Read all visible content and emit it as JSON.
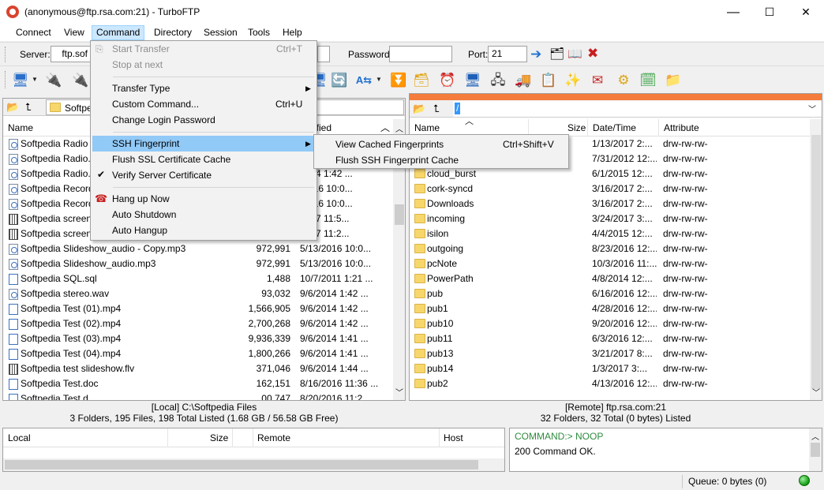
{
  "window": {
    "title": "(anonymous@ftp.rsa.com:21) - TurboFTP",
    "minimize": "—",
    "maximize": "☐",
    "close": "✕"
  },
  "menubar": [
    "Connect",
    "View",
    "Command",
    "Directory",
    "Session",
    "Tools",
    "Help"
  ],
  "connection": {
    "server_label": "Server:",
    "server_value": "ftp.sof",
    "password_label": "Password:",
    "password_value": "",
    "port_label": "Port:",
    "port_value": "21"
  },
  "command_menu": {
    "items": [
      {
        "label": "Start Transfer",
        "shortcut": "Ctrl+T",
        "disabled": true
      },
      {
        "label": "Stop at next",
        "shortcut": "",
        "disabled": true
      },
      {
        "label": "Transfer Type",
        "shortcut": "",
        "submenu": true
      },
      {
        "label": "Custom Command...",
        "shortcut": "Ctrl+U"
      },
      {
        "label": "Change Login Password",
        "shortcut": ""
      },
      {
        "label": "SSH Fingerprint",
        "shortcut": "",
        "submenu": true,
        "highlighted": true
      },
      {
        "label": "Flush SSL Certificate Cache",
        "shortcut": ""
      },
      {
        "label": "Verify Server Certificate",
        "shortcut": "",
        "checked": true
      },
      {
        "label": "Hang up Now",
        "shortcut": ""
      },
      {
        "label": "Auto Shutdown",
        "shortcut": ""
      },
      {
        "label": "Auto Hangup",
        "shortcut": ""
      }
    ]
  },
  "ssh_submenu": {
    "items": [
      {
        "label": "View Cached Fingerprints",
        "shortcut": "Ctrl+Shift+V"
      },
      {
        "label": "Flush SSH Fingerprint Cache",
        "shortcut": ""
      }
    ]
  },
  "local": {
    "path": "Softped",
    "columns": {
      "name": "Name",
      "modified": "ified"
    },
    "files": [
      {
        "name": "Softpedia Radio .",
        "size": "",
        "date": "",
        "icon": "aud"
      },
      {
        "name": "Softpedia Radio.r",
        "size": "",
        "date": "",
        "icon": "aud"
      },
      {
        "name": "Softpedia Radio.v",
        "size": "",
        "date": "2014 1:42 ...",
        "icon": "aud"
      },
      {
        "name": "Softpedia Record",
        "size": "",
        "date": "/2016 10:0...",
        "icon": "aud"
      },
      {
        "name": "Softpedia Record",
        "size": "",
        "date": "/2016 10:0...",
        "icon": "aud"
      },
      {
        "name": "Softpedia screen",
        "size": "",
        "date": "2017 11:5...",
        "icon": "vid"
      },
      {
        "name": "Softpedia screen",
        "size": "",
        "date": "2017 11:2...",
        "icon": "vid"
      },
      {
        "name": "Softpedia Slideshow_audio - Copy.mp3",
        "size": "972,991",
        "date": "5/13/2016 10:0...",
        "icon": "aud"
      },
      {
        "name": "Softpedia Slideshow_audio.mp3",
        "size": "972,991",
        "date": "5/13/2016 10:0...",
        "icon": "aud"
      },
      {
        "name": "Softpedia SQL.sql",
        "size": "1,488",
        "date": "10/7/2011 1:21 ...",
        "icon": "doc"
      },
      {
        "name": "Softpedia stereo.wav",
        "size": "93,032",
        "date": "9/6/2014 1:42 ...",
        "icon": "aud"
      },
      {
        "name": "Softpedia Test (01).mp4",
        "size": "1,566,905",
        "date": "9/6/2014 1:42 ...",
        "icon": "doc"
      },
      {
        "name": "Softpedia Test (02).mp4",
        "size": "2,700,268",
        "date": "9/6/2014 1:42 ...",
        "icon": "doc"
      },
      {
        "name": "Softpedia Test (03).mp4",
        "size": "9,936,339",
        "date": "9/6/2014 1:41 ...",
        "icon": "doc"
      },
      {
        "name": "Softpedia Test (04).mp4",
        "size": "1,800,266",
        "date": "9/6/2014 1:41 ...",
        "icon": "doc"
      },
      {
        "name": "Softpedia test slideshow.flv",
        "size": "371,046",
        "date": "9/6/2014 1:44 ...",
        "icon": "vid"
      },
      {
        "name": "Softpedia Test.doc",
        "size": "162,151",
        "date": "8/16/2016 11:36 ...",
        "icon": "doc"
      },
      {
        "name": "Softpedia Test.d...",
        "size": "00,747",
        "date": "8/20/2016 11:2...",
        "icon": "doc"
      }
    ],
    "status_line1": "[Local] C:\\Softpedia Files",
    "status_line2": "3 Folders, 195 Files, 198 Total Listed (1.68 GB / 56.58 GB Free)"
  },
  "remote": {
    "path": "/",
    "columns": {
      "name": "Name",
      "size": "Size",
      "date": "Date/Time",
      "attr": "Attribute"
    },
    "rows": [
      {
        "name": "",
        "date": "1/13/2017 2:...",
        "attr": "drw-rw-rw-"
      },
      {
        "name": "bustech",
        "date": "7/31/2012 12:...",
        "attr": "drw-rw-rw-"
      },
      {
        "name": "cloud_burst",
        "date": "6/1/2015 12:...",
        "attr": "drw-rw-rw-"
      },
      {
        "name": "cork-syncd",
        "date": "3/16/2017 2:...",
        "attr": "drw-rw-rw-"
      },
      {
        "name": "Downloads",
        "date": "3/16/2017 2:...",
        "attr": "drw-rw-rw-"
      },
      {
        "name": "incoming",
        "date": "3/24/2017 3:...",
        "attr": "drw-rw-rw-"
      },
      {
        "name": "isilon",
        "date": "4/4/2015 12:...",
        "attr": "drw-rw-rw-"
      },
      {
        "name": "outgoing",
        "date": "8/23/2016 12:...",
        "attr": "drw-rw-rw-"
      },
      {
        "name": "pcNote",
        "date": "10/3/2016 11:...",
        "attr": "drw-rw-rw-"
      },
      {
        "name": "PowerPath",
        "date": "4/8/2014 12:...",
        "attr": "drw-rw-rw-"
      },
      {
        "name": "pub",
        "date": "6/16/2016 12:...",
        "attr": "drw-rw-rw-"
      },
      {
        "name": "pub1",
        "date": "4/28/2016 12:...",
        "attr": "drw-rw-rw-"
      },
      {
        "name": "pub10",
        "date": "9/20/2016 12:...",
        "attr": "drw-rw-rw-"
      },
      {
        "name": "pub11",
        "date": "6/3/2016 12:...",
        "attr": "drw-rw-rw-"
      },
      {
        "name": "pub13",
        "date": "3/21/2017 8:...",
        "attr": "drw-rw-rw-"
      },
      {
        "name": "pub14",
        "date": "1/3/2017 3:...",
        "attr": "drw-rw-rw-"
      },
      {
        "name": "pub2",
        "date": "4/13/2016 12:...",
        "attr": "drw-rw-rw-"
      }
    ],
    "status_line1": "[Remote] ftp.rsa.com:21",
    "status_line2": "32 Folders, 32 Total (0 bytes) Listed"
  },
  "queue": {
    "columns": {
      "local": "Local",
      "size": "Size",
      "remote": "Remote",
      "host": "Host"
    },
    "status": "Queue: 0 bytes  (0)"
  },
  "log": {
    "line1": "COMMAND:> NOOP",
    "line2": "200 Command OK."
  },
  "colors": {
    "accent_orange": "#f47c3c",
    "menu_highlight": "#91c9f7",
    "log_green": "#2e8b3e"
  }
}
